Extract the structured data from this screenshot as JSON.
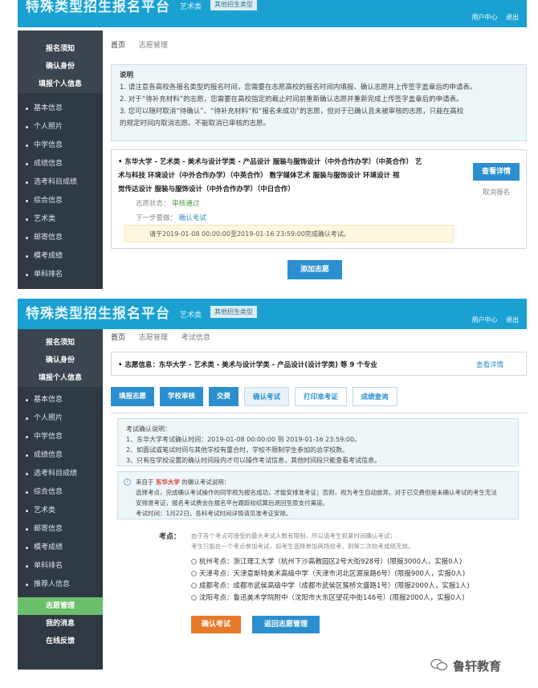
{
  "header": {
    "title": "特殊类型招生报名平台",
    "subtitle": "艺术类",
    "type_chip": "其他招生类型",
    "user_center": "用户中心",
    "logout": "退出"
  },
  "sidebar": {
    "sections": [
      "报名须知",
      "确认身份",
      "填报个人信息"
    ],
    "items": [
      "基本信息",
      "个人照片",
      "中学信息",
      "成绩信息",
      "选考科目成绩",
      "综合信息",
      "艺术类",
      "邮寄信息",
      "模考成绩",
      "单科排名",
      "推荐人信息"
    ],
    "bottom_sections": [
      "志愿管理",
      "我的消息",
      "在线反馈"
    ]
  },
  "screen1": {
    "breadcrumb": [
      "首页",
      "志愿管理"
    ],
    "notice": {
      "title": "说明",
      "lines": [
        "1. 请注意各高校各报名类型的报名时间，您需要在志愿高校的报名时间内填报、确认志愿并上传签字盖章后的申请表。",
        "2. 对于“待补充材料”的志愿，您需要在高校指定的截止时间前重新确认志愿并重新完成上传签字盖章后的申请表。",
        "3. 您可以随时取消“待确认”、“待补充材料”和“报名未成功”的志愿，但对于已确认且未被审核的志愿，只能在高校",
        "的规定时间内取消志愿。不能取消已审核的志愿。"
      ]
    },
    "application": {
      "title_lines": [
        "• 东华大学 - 艺术类 - 美术与设计学类 - 产品设计   服装与服饰设计（中外合作办学）（中英合作）   艺",
        "术与科技   环境设计（中外合作办学）（中英合作）   数字媒体艺术   服装与服饰设计   环境设计   视",
        "觉传达设计   服装与服饰设计（中外合作办学）（中日合作）"
      ],
      "status_label": "志愿状态：",
      "status_value": "审核通过",
      "next_label": "下一步要做：",
      "next_value": "确认考试",
      "notice": "请于2019-01-08 00:00:00至2019-01-16 23:59:00完成确认考试。",
      "detail_button": "查看详情",
      "cancel_button": "取消报名"
    },
    "add_button": "添加志愿"
  },
  "screen2": {
    "breadcrumb": [
      "首页",
      "志愿管理",
      "考试信息"
    ],
    "summary": "• 志愿信息：东华大学 - 艺术类 - 美术与设计学类 - 产品设计(设计学类) 等 9 个专业",
    "summary_link": "查看详情",
    "tabs": [
      "填报志愿",
      "学校审核",
      "交费",
      "确认考试",
      "打印准考证",
      "成绩查询"
    ],
    "confirm_notice": {
      "title": "考试确认说明：",
      "lines": [
        "1、东华大学考试确认时间：2019-01-08 00:00:00 到 2019-01-16 23:59:00。",
        "2、如面试或笔试时间与其他学校有重合时，学校不限制学生参加的总学校数。",
        "3、只有在学校设置的确认时间段内才可以操作考试信息，其他时间段只能查看考试信息。"
      ]
    },
    "school_notice": {
      "prefix": "来自于",
      "school": "东华大学",
      "suffix": "的确认考试说明：",
      "lines": [
        "选择考点，完成确认考试操作的同学视为报名成功，才能安排准考证；否则，视为考生自动放弃。对于已交费但是未确认考试的考生无法",
        "安排准考证，报名考试费会在报名平台跟踪校结算后退回至原支付渠道。",
        "考试时间：1月22日，各科考试时间详情请见准考证安排。"
      ]
    },
    "exam": {
      "label": "考点：",
      "hint_lines": [
        "由于各个考点可接受的最大考试人数有限制，所以请考生抓紧时间确认考试；",
        "考生只能在一个考点参加考试，如考生选择参加两场校考，则第二次校考成绩无效。"
      ],
      "sites": [
        "杭州考点：浙江理工大学（杭州下沙高教园区2号大街928号）(限报3000人，实报0人)",
        "天津考点：天津意斯特美术高级中学（天津市河北区源泉路6号）(限报900人，实报0人)",
        "成都考点：成都市武侯高级中学（成都市武侯区簇桥文盛路1号）(限报2000人，实报1人)",
        "沈阳考点：鲁迅美术学院附中（沈阳市大东区望花中街146号）(限报2000人，实报0人)"
      ]
    },
    "confirm_button": "确认考试",
    "back_button": "返回志愿管理"
  },
  "watermark": "鲁轩教育",
  "colors": {
    "header_blue": "#1aa1d2",
    "sidebar_dark": "#2e3943",
    "button_blue": "#2b8fcf",
    "button_orange": "#e77a2a",
    "active_green": "#6bbf6a"
  }
}
